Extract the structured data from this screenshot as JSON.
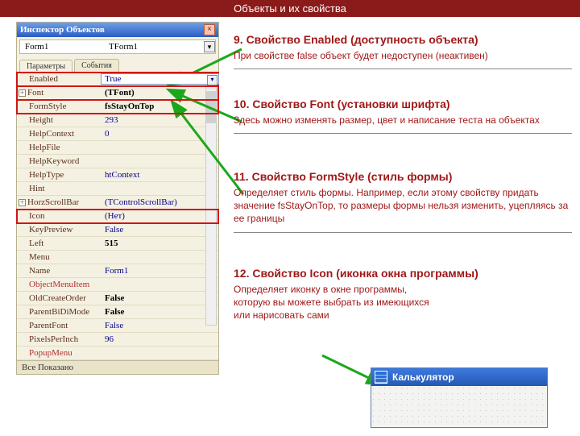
{
  "banner": "Объекты и их свойства",
  "oi": {
    "title": "Инспектор Объектов",
    "instance": "Form1",
    "instanceType": "TForm1",
    "tabs": {
      "params": "Параметры",
      "events": "События"
    },
    "status": "Все Показано",
    "rows": [
      {
        "name": "Enabled",
        "val": "True",
        "sel": true,
        "hl": true
      },
      {
        "name": "Font",
        "val": "(TFont)",
        "exp": true,
        "hl": true,
        "bold": true
      },
      {
        "name": "FormStyle",
        "val": "fsStayOnTop",
        "hl": true,
        "bold": true
      },
      {
        "name": "Height",
        "val": "293"
      },
      {
        "name": "HelpContext",
        "val": "0"
      },
      {
        "name": "HelpFile",
        "val": ""
      },
      {
        "name": "HelpKeyword",
        "val": ""
      },
      {
        "name": "HelpType",
        "val": "htContext"
      },
      {
        "name": "Hint",
        "val": ""
      },
      {
        "name": "HorzScrollBar",
        "val": "(TControlScrollBar)",
        "exp": true
      },
      {
        "name": "Icon",
        "val": "(Нет)",
        "hl": true
      },
      {
        "name": "KeyPreview",
        "val": "False"
      },
      {
        "name": "Left",
        "val": "515",
        "bold": true
      },
      {
        "name": "Menu",
        "val": ""
      },
      {
        "name": "Name",
        "val": "Form1"
      },
      {
        "name": "ObjectMenuItem",
        "val": "",
        "linked": true
      },
      {
        "name": "OldCreateOrder",
        "val": "False",
        "bold": true
      },
      {
        "name": "ParentBiDiMode",
        "val": "False",
        "bold": true
      },
      {
        "name": "ParentFont",
        "val": "False"
      },
      {
        "name": "PixelsPerInch",
        "val": "96"
      },
      {
        "name": "PopupMenu",
        "val": "",
        "linked": true
      }
    ]
  },
  "sections": {
    "s9": {
      "title": "9. Свойство Enabled (доступность объекта)",
      "desc": "При свойстве false объект будет недоступен (неактивен)"
    },
    "s10": {
      "title": "10. Свойство Font (установки шрифта)",
      "desc": "Здесь можно изменять размер, цвет и написание теста на объектах"
    },
    "s11": {
      "title": "11. Свойство FormStyle (стиль формы)",
      "desc": "Определяет стиль формы. Например, если этому свойству придать значение fsStayOnTop, то размеры формы нельзя изменить, уцепляясь за ее границы"
    },
    "s12": {
      "title": "12. Свойство Icon (иконка окна программы)",
      "desc": "Определяет иконку в окне программы, которую вы можете выбрать из имеющихся или нарисовать сами"
    }
  },
  "calc": {
    "title": "Калькулятор"
  }
}
